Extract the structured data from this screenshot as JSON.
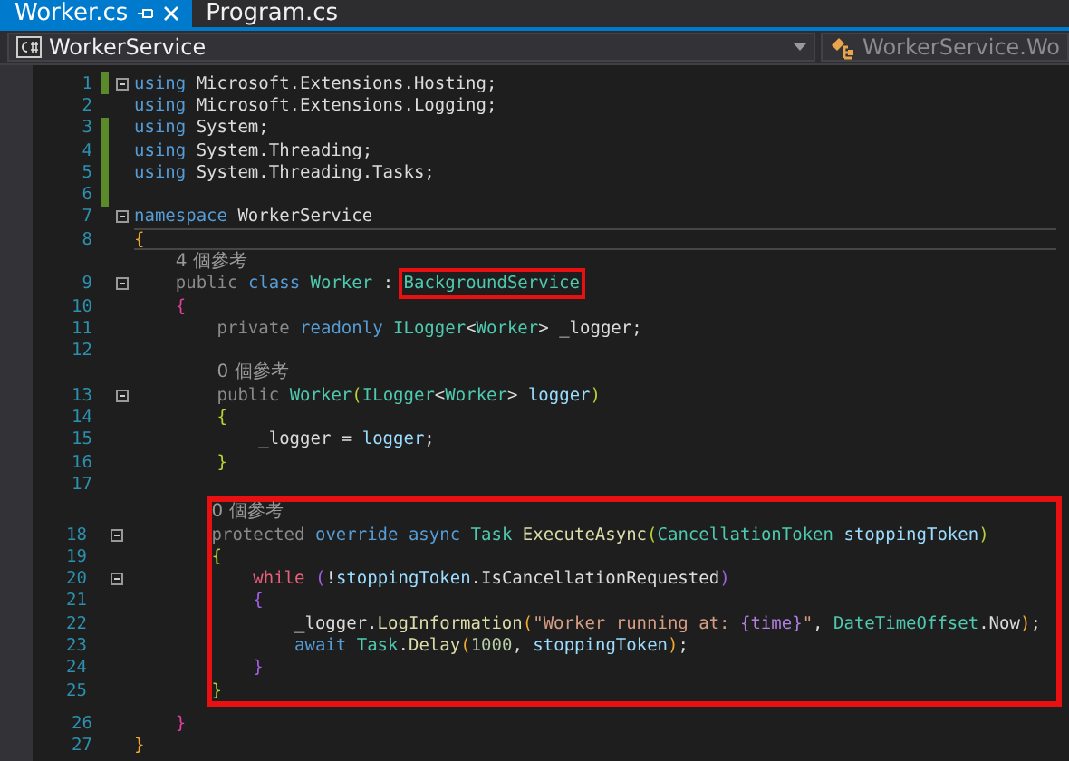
{
  "tabs": [
    {
      "label": "Worker.cs",
      "selected": true
    },
    {
      "label": "Program.cs",
      "selected": false
    }
  ],
  "nav": {
    "project": "WorkerService",
    "member": "WorkerService.Wo"
  },
  "blocks": [
    {
      "boxed": false,
      "lines": [
        {
          "kind": "code",
          "number": "1",
          "changed": true,
          "fold": true,
          "current": false,
          "tokens": [
            {
              "text": "using",
              "kind": "kw"
            },
            {
              "text": " Microsoft.Extensions.Hosting;",
              "kind": "plain"
            }
          ]
        },
        {
          "kind": "code",
          "number": "2",
          "changed": false,
          "fold": false,
          "current": false,
          "tokens": [
            {
              "text": "using",
              "kind": "kw"
            },
            {
              "text": " Microsoft.Extensions.Logging;",
              "kind": "plain"
            }
          ]
        },
        {
          "kind": "code",
          "number": "3",
          "changed": true,
          "fold": false,
          "current": false,
          "tokens": [
            {
              "text": "using",
              "kind": "kw"
            },
            {
              "text": " System;",
              "kind": "plain"
            }
          ]
        },
        {
          "kind": "code",
          "number": "4",
          "changed": true,
          "fold": false,
          "current": false,
          "tokens": [
            {
              "text": "using",
              "kind": "kw"
            },
            {
              "text": " System.Threading;",
              "kind": "plain"
            }
          ]
        },
        {
          "kind": "code",
          "number": "5",
          "changed": true,
          "fold": false,
          "current": false,
          "tokens": [
            {
              "text": "using",
              "kind": "kw"
            },
            {
              "text": " System.Threading.Tasks;",
              "kind": "plain"
            }
          ]
        },
        {
          "kind": "code",
          "number": "6",
          "changed": true,
          "fold": false,
          "current": false
        },
        {
          "kind": "code",
          "number": "7",
          "changed": false,
          "fold": true,
          "current": false,
          "tokens": [
            {
              "text": "namespace",
              "kind": "kw"
            },
            {
              "text": " WorkerService",
              "kind": "plain"
            }
          ]
        },
        {
          "kind": "code",
          "number": "8",
          "changed": false,
          "fold": false,
          "current": true,
          "tokens": [
            {
              "text": "{",
              "kind": "brace1"
            }
          ]
        },
        {
          "kind": "lens",
          "text": "    4 個參考"
        },
        {
          "kind": "code",
          "number": "9",
          "changed": false,
          "fold": true,
          "current": false,
          "tokens": [
            {
              "text": "    public",
              "kind": "dim"
            },
            {
              "text": " class",
              "kind": "kw"
            },
            {
              "text": " Worker",
              "kind": "type"
            },
            {
              "text": " : ",
              "kind": "plain"
            },
            {
              "text": "BackgroundService",
              "kind": "type",
              "highlighted": true
            }
          ]
        },
        {
          "kind": "code",
          "number": "10",
          "changed": false,
          "fold": false,
          "current": false,
          "tokens": [
            {
              "text": "    {",
              "kind": "brace2"
            }
          ]
        },
        {
          "kind": "code",
          "number": "11",
          "changed": false,
          "fold": false,
          "current": false,
          "tokens": [
            {
              "text": "        private",
              "kind": "dim"
            },
            {
              "text": " readonly",
              "kind": "kw"
            },
            {
              "text": " ILogger",
              "kind": "type"
            },
            {
              "text": "<",
              "kind": "plain"
            },
            {
              "text": "Worker",
              "kind": "type"
            },
            {
              "text": "> _logger;",
              "kind": "plain"
            }
          ]
        },
        {
          "kind": "code",
          "number": "12",
          "changed": false,
          "fold": false,
          "current": false
        },
        {
          "kind": "lens",
          "text": "        0 個參考"
        },
        {
          "kind": "code",
          "number": "13",
          "changed": false,
          "fold": true,
          "current": false,
          "tokens": [
            {
              "text": "        public",
              "kind": "dim"
            },
            {
              "text": " Worker",
              "kind": "type"
            },
            {
              "text": "(",
              "kind": "brace3"
            },
            {
              "text": "ILogger",
              "kind": "type"
            },
            {
              "text": "<",
              "kind": "plain"
            },
            {
              "text": "Worker",
              "kind": "type"
            },
            {
              "text": "> ",
              "kind": "plain"
            },
            {
              "text": "logger",
              "kind": "param"
            },
            {
              "text": ")",
              "kind": "brace3"
            }
          ]
        },
        {
          "kind": "code",
          "number": "14",
          "changed": false,
          "fold": false,
          "current": false,
          "tokens": [
            {
              "text": "        {",
              "kind": "brace3"
            }
          ]
        },
        {
          "kind": "code",
          "number": "15",
          "changed": false,
          "fold": false,
          "current": false,
          "tokens": [
            {
              "text": "            _logger = ",
              "kind": "plain"
            },
            {
              "text": "logger",
              "kind": "param"
            },
            {
              "text": ";",
              "kind": "plain"
            }
          ]
        },
        {
          "kind": "code",
          "number": "16",
          "changed": false,
          "fold": false,
          "current": false,
          "tokens": [
            {
              "text": "        }",
              "kind": "brace3"
            }
          ]
        },
        {
          "kind": "code",
          "number": "17",
          "changed": false,
          "fold": false,
          "current": false
        }
      ]
    },
    {
      "boxed": true,
      "lines": [
        {
          "kind": "lens",
          "text": "        0 個參考"
        },
        {
          "kind": "code",
          "number": "18",
          "changed": false,
          "fold": true,
          "current": false,
          "tokens": [
            {
              "text": "        protected",
              "kind": "dim"
            },
            {
              "text": " override",
              "kind": "kw"
            },
            {
              "text": " async",
              "kind": "kw"
            },
            {
              "text": " Task",
              "kind": "type"
            },
            {
              "text": " ExecuteAsync",
              "kind": "method"
            },
            {
              "text": "(",
              "kind": "brace3"
            },
            {
              "text": "CancellationToken",
              "kind": "type"
            },
            {
              "text": " stoppingToken",
              "kind": "param"
            },
            {
              "text": ")",
              "kind": "brace3"
            }
          ]
        },
        {
          "kind": "code",
          "number": "19",
          "changed": false,
          "fold": false,
          "current": false,
          "tokens": [
            {
              "text": "        {",
              "kind": "brace3"
            }
          ]
        },
        {
          "kind": "code",
          "number": "20",
          "changed": false,
          "fold": true,
          "current": false,
          "tokens": [
            {
              "text": "            while",
              "kind": "ctrl"
            },
            {
              "text": " (",
              "kind": "brace4"
            },
            {
              "text": "!",
              "kind": "plain"
            },
            {
              "text": "stoppingToken",
              "kind": "param"
            },
            {
              "text": ".IsCancellationRequested",
              "kind": "plain"
            },
            {
              "text": ")",
              "kind": "brace4"
            }
          ]
        },
        {
          "kind": "code",
          "number": "21",
          "changed": false,
          "fold": false,
          "current": false,
          "tokens": [
            {
              "text": "            {",
              "kind": "brace4"
            }
          ]
        },
        {
          "kind": "code",
          "number": "22",
          "changed": false,
          "fold": false,
          "current": false,
          "tokens": [
            {
              "text": "                _logger.",
              "kind": "plain"
            },
            {
              "text": "LogInformation",
              "kind": "method"
            },
            {
              "text": "(",
              "kind": "brace1"
            },
            {
              "text": "\"Worker running at: ",
              "kind": "string"
            },
            {
              "text": "{time}",
              "kind": "fmt"
            },
            {
              "text": "\"",
              "kind": "string"
            },
            {
              "text": ", ",
              "kind": "plain"
            },
            {
              "text": "DateTimeOffset",
              "kind": "type"
            },
            {
              "text": ".Now",
              "kind": "plain"
            },
            {
              "text": ")",
              "kind": "brace1"
            },
            {
              "text": ";",
              "kind": "plain"
            }
          ]
        },
        {
          "kind": "code",
          "number": "23",
          "changed": false,
          "fold": false,
          "current": false,
          "tokens": [
            {
              "text": "                await",
              "kind": "kw"
            },
            {
              "text": " Task",
              "kind": "type"
            },
            {
              "text": ".",
              "kind": "plain"
            },
            {
              "text": "Delay",
              "kind": "method"
            },
            {
              "text": "(",
              "kind": "brace1"
            },
            {
              "text": "1000",
              "kind": "num"
            },
            {
              "text": ", ",
              "kind": "plain"
            },
            {
              "text": "stoppingToken",
              "kind": "param"
            },
            {
              "text": ")",
              "kind": "brace1"
            },
            {
              "text": ";",
              "kind": "plain"
            }
          ]
        },
        {
          "kind": "code",
          "number": "24",
          "changed": false,
          "fold": false,
          "current": false,
          "tokens": [
            {
              "text": "            }",
              "kind": "brace4"
            }
          ]
        },
        {
          "kind": "code",
          "number": "25",
          "changed": false,
          "fold": false,
          "current": false,
          "tokens": [
            {
              "text": "        }",
              "kind": "brace3"
            }
          ]
        }
      ]
    },
    {
      "boxed": false,
      "lines": [
        {
          "kind": "code",
          "number": "26",
          "changed": false,
          "fold": false,
          "current": false,
          "tokens": [
            {
              "text": "    }",
              "kind": "brace2"
            }
          ]
        },
        {
          "kind": "code",
          "number": "27",
          "changed": false,
          "fold": false,
          "current": false,
          "tokens": [
            {
              "text": "}",
              "kind": "brace1"
            }
          ]
        }
      ]
    }
  ]
}
